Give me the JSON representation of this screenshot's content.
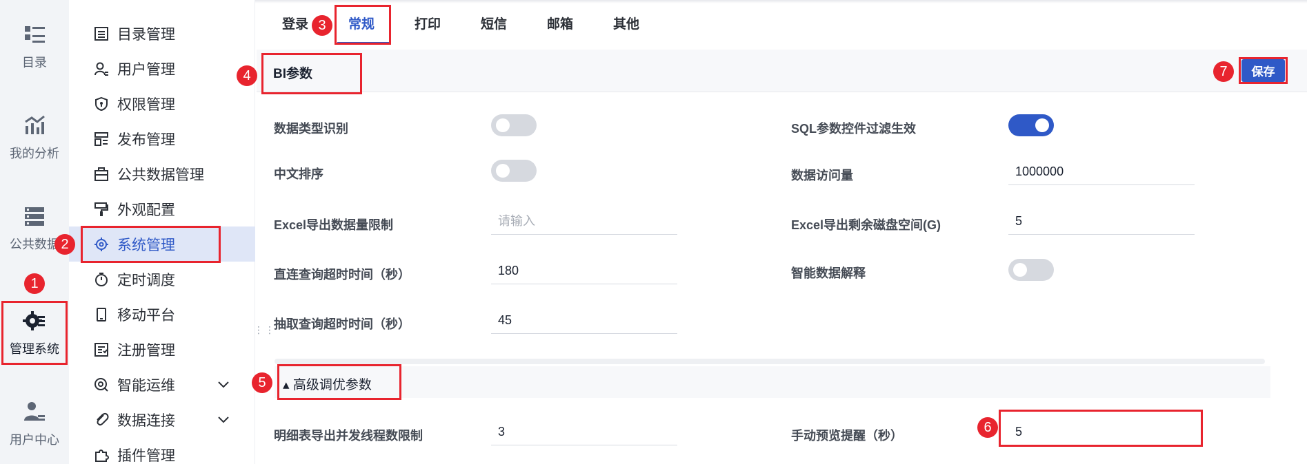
{
  "rail": {
    "items": [
      {
        "label": "目录",
        "icon": "catalog-icon"
      },
      {
        "label": "我的分析",
        "icon": "analysis-icon"
      },
      {
        "label": "公共数据",
        "icon": "public-data-icon"
      },
      {
        "label": "管理系统",
        "icon": "gear-icon",
        "active": true
      },
      {
        "label": "用户中心",
        "icon": "user-center-icon"
      }
    ]
  },
  "menu": {
    "items": [
      {
        "label": "目录管理",
        "icon": "list-icon"
      },
      {
        "label": "用户管理",
        "icon": "user-icon"
      },
      {
        "label": "权限管理",
        "icon": "shield-icon"
      },
      {
        "label": "发布管理",
        "icon": "publish-icon"
      },
      {
        "label": "公共数据管理",
        "icon": "briefcase-icon"
      },
      {
        "label": "外观配置",
        "icon": "brush-icon"
      },
      {
        "label": "系统管理",
        "icon": "gear-icon",
        "active": true
      },
      {
        "label": "定时调度",
        "icon": "timer-icon"
      },
      {
        "label": "移动平台",
        "icon": "mobile-icon"
      },
      {
        "label": "注册管理",
        "icon": "register-icon"
      },
      {
        "label": "智能运维",
        "icon": "ops-icon",
        "expandable": true
      },
      {
        "label": "数据连接",
        "icon": "link-icon",
        "expandable": true
      },
      {
        "label": "插件管理",
        "icon": "plugin-icon"
      }
    ]
  },
  "tabs": [
    {
      "label": "登录"
    },
    {
      "label": "常规",
      "active": true
    },
    {
      "label": "打印"
    },
    {
      "label": "短信"
    },
    {
      "label": "邮箱"
    },
    {
      "label": "其他"
    }
  ],
  "panel": {
    "title": "BI参数",
    "save_label": "保存"
  },
  "fields": {
    "data_type_recognition": {
      "label": "数据类型识别",
      "on": false
    },
    "sql_param_filter": {
      "label": "SQL参数控件过滤生效",
      "on": true
    },
    "chinese_sort": {
      "label": "中文排序",
      "on": false
    },
    "data_access_volume": {
      "label": "数据访问量",
      "value": "1000000"
    },
    "excel_export_limit": {
      "label": "Excel导出数据量限制",
      "value": "",
      "placeholder": "请输入"
    },
    "excel_disk_space": {
      "label": "Excel导出剩余磁盘空间(G)",
      "value": "5"
    },
    "direct_query_timeout": {
      "label": "直连查询超时时间（秒）",
      "value": "180"
    },
    "smart_data_explain": {
      "label": "智能数据解释",
      "on": false
    },
    "extract_query_timeout": {
      "label": "抽取查询超时时间（秒）",
      "value": "45"
    }
  },
  "advanced": {
    "title": "▴ 高级调优参数",
    "detail_export_threads": {
      "label": "明细表导出并发线程数限制",
      "value": "3"
    },
    "manual_preview_reminder": {
      "label": "手动预览提醒（秒）",
      "value": "5"
    }
  },
  "badges": [
    "1",
    "2",
    "3",
    "4",
    "5",
    "6",
    "7"
  ],
  "colors": {
    "accent": "#2f59c7",
    "highlight": "#e8242e",
    "active_menu_bg": "#dfe6f7"
  }
}
